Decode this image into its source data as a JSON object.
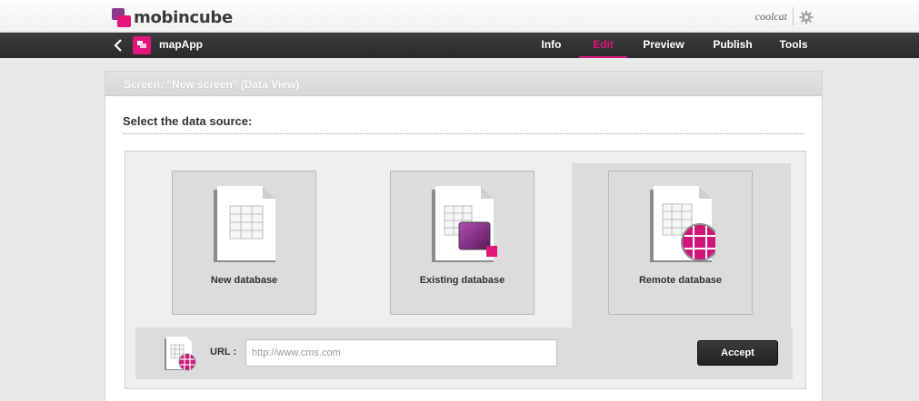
{
  "brand": {
    "name": "mobincube",
    "accent": "#e1157a",
    "purple": "#8a3a8a"
  },
  "user": {
    "name": "coolcat",
    "settings_icon": "gear-icon"
  },
  "appbar": {
    "back_icon": "chevron-left-icon",
    "app_name": "mapApp",
    "nav": [
      {
        "label": "Info",
        "active": false
      },
      {
        "label": "Edit",
        "active": true
      },
      {
        "label": "Preview",
        "active": false
      },
      {
        "label": "Publish",
        "active": false
      },
      {
        "label": "Tools",
        "active": false
      }
    ]
  },
  "card": {
    "header": "Screen: \"New screen\" (Data View)",
    "section_title": "Select the data source:"
  },
  "sources": [
    {
      "label": "New database",
      "icon": "new-database-icon",
      "selected": false
    },
    {
      "label": "Existing database",
      "icon": "existing-database-icon",
      "selected": false
    },
    {
      "label": "Remote database",
      "icon": "remote-database-icon",
      "selected": true
    }
  ],
  "url_form": {
    "label": "URL :",
    "placeholder": "http://www.cms.com",
    "value": "",
    "accept_label": "Accept"
  }
}
